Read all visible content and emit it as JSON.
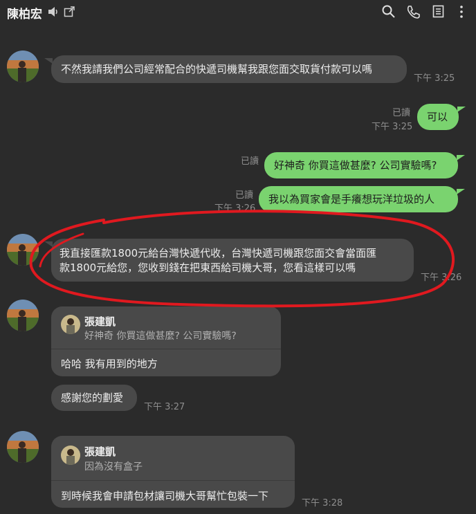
{
  "header": {
    "title": "陳柏宏",
    "icons": [
      "speaker-icon",
      "external-window-icon",
      "search-icon",
      "phone-icon",
      "notes-icon",
      "more-vertical-icon"
    ]
  },
  "messages": [
    {
      "dir": "in",
      "text": "不然我請我們公司經常配合的快遞司機幫我跟您面交取貨付款可以嗎",
      "time": "下午 3:25"
    },
    {
      "dir": "out",
      "text": "可以",
      "read": "已讀",
      "time": "下午 3:25"
    },
    {
      "dir": "out",
      "text": "好神奇 你買這做甚麼? 公司實驗嗎?",
      "read": "已讀"
    },
    {
      "dir": "out",
      "text": "我以為買家會是手癢想玩洋垃圾的人",
      "read": "已讀",
      "time": "下午 3:26"
    },
    {
      "dir": "in",
      "line1": "我直接匯款1800元給台灣快遞代收，台灣快遞司機跟您面交會當面匯",
      "line2": "款1800元給您，您收到錢在把東西給司機大哥，您看這樣可以嗎",
      "time": "下午 3:26"
    },
    {
      "dir": "in",
      "quote_name": "張建凱",
      "quote_text": "好神奇 你買這做甚麼? 公司實驗嗎?",
      "text": "哈哈 我有用到的地方"
    },
    {
      "dir": "in",
      "text": "感謝您的劃愛",
      "time": "下午 3:27"
    },
    {
      "dir": "in",
      "quote_name": "張建凱",
      "quote_text": "因為沒有盒子",
      "text": "到時候我會申請包材讓司機大哥幫忙包裝一下",
      "time": "下午 3:28"
    }
  ],
  "colors": {
    "background": "#2b2b2b",
    "incoming": "#494949",
    "outgoing": "#7ad36f",
    "annotation": "#e0191f"
  }
}
